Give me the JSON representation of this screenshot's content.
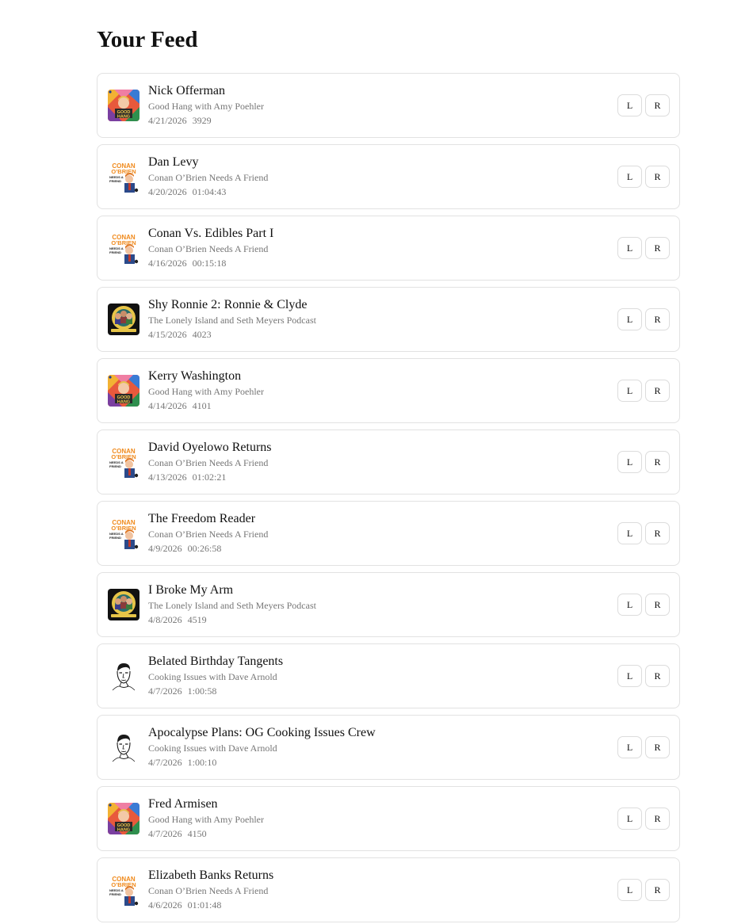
{
  "page": {
    "title": "Your Feed"
  },
  "buttons": {
    "left_label": "L",
    "right_label": "R"
  },
  "feed": [
    {
      "title": "Nick Offerman",
      "show": "Good Hang with Amy Poehler",
      "date": "4/21/2026",
      "duration": "3929",
      "artwork": "good-hang-artwork"
    },
    {
      "title": "Dan Levy",
      "show": "Conan O’Brien Needs A Friend",
      "date": "4/20/2026",
      "duration": "01:04:43",
      "artwork": "conan-artwork"
    },
    {
      "title": "Conan Vs. Edibles Part I",
      "show": "Conan O’Brien Needs A Friend",
      "date": "4/16/2026",
      "duration": "00:15:18",
      "artwork": "conan-artwork"
    },
    {
      "title": "Shy Ronnie 2: Ronnie & Clyde",
      "show": "The Lonely Island and Seth Meyers Podcast",
      "date": "4/15/2026",
      "duration": "4023",
      "artwork": "lonely-island-artwork"
    },
    {
      "title": "Kerry Washington",
      "show": "Good Hang with Amy Poehler",
      "date": "4/14/2026",
      "duration": "4101",
      "artwork": "good-hang-artwork"
    },
    {
      "title": "David Oyelowo Returns",
      "show": "Conan O’Brien Needs A Friend",
      "date": "4/13/2026",
      "duration": "01:02:21",
      "artwork": "conan-artwork"
    },
    {
      "title": "The Freedom Reader",
      "show": "Conan O’Brien Needs A Friend",
      "date": "4/9/2026",
      "duration": "00:26:58",
      "artwork": "conan-artwork"
    },
    {
      "title": "I Broke My Arm",
      "show": "The Lonely Island and Seth Meyers Podcast",
      "date": "4/8/2026",
      "duration": "4519",
      "artwork": "lonely-island-artwork"
    },
    {
      "title": "Belated Birthday Tangents",
      "show": "Cooking Issues with Dave Arnold",
      "date": "4/7/2026",
      "duration": "1:00:58",
      "artwork": "cooking-issues-artwork"
    },
    {
      "title": "Apocalypse Plans: OG Cooking Issues Crew",
      "show": "Cooking Issues with Dave Arnold",
      "date": "4/7/2026",
      "duration": "1:00:10",
      "artwork": "cooking-issues-artwork"
    },
    {
      "title": "Fred Armisen",
      "show": "Good Hang with Amy Poehler",
      "date": "4/7/2026",
      "duration": "4150",
      "artwork": "good-hang-artwork"
    },
    {
      "title": "Elizabeth Banks Returns",
      "show": "Conan O’Brien Needs A Friend",
      "date": "4/6/2026",
      "duration": "01:01:48",
      "artwork": "conan-artwork"
    }
  ],
  "artwork_text": {
    "good_hang": "GOOD HANG",
    "conan": "CONAN O'BRIEN NEEDS A FRIEND"
  },
  "colors": {
    "card_border": "#e2e2e2",
    "muted_text": "#767676",
    "conan_orange": "#f08a1c",
    "good_hang_green": "#2f8f4e"
  }
}
